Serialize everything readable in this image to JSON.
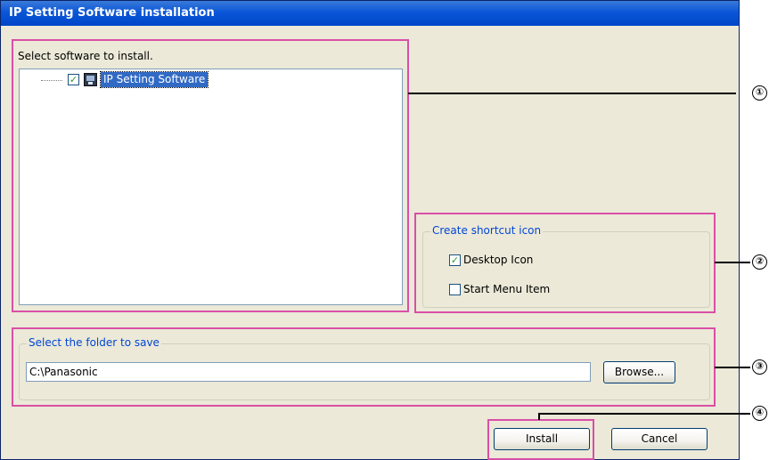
{
  "window": {
    "title": "IP Setting Software installation"
  },
  "software_panel": {
    "label": "Select software to install.",
    "items": [
      {
        "label": "IP Setting Software",
        "checked": true
      }
    ]
  },
  "shortcut_group": {
    "legend": "Create shortcut icon",
    "options": [
      {
        "label": "Desktop Icon",
        "checked": true
      },
      {
        "label": "Start Menu Item",
        "checked": false
      }
    ]
  },
  "folder_group": {
    "legend": "Select the folder to save",
    "path_value": "C:\\Panasonic",
    "browse_label": "Browse..."
  },
  "buttons": {
    "install_label": "Install",
    "cancel_label": "Cancel"
  },
  "callouts": [
    "①",
    "②",
    "③",
    "④"
  ],
  "colors": {
    "titlebar": "#0a56d8",
    "highlight": "#316ac5",
    "outline": "#d94fa6",
    "legend_text": "#0046d5"
  }
}
